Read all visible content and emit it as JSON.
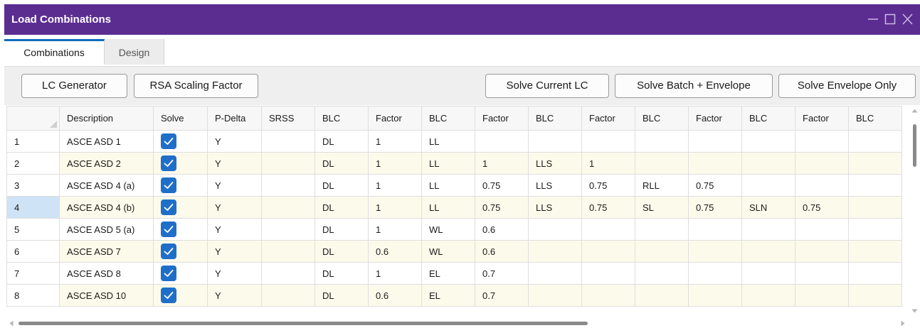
{
  "window": {
    "title": "Load Combinations"
  },
  "tabs": [
    {
      "label": "Combinations",
      "active": true
    },
    {
      "label": "Design",
      "active": false
    }
  ],
  "toolbar": {
    "lc_generator": "LC Generator",
    "rsa_scaling": "RSA Scaling Factor",
    "solve_current": "Solve Current LC",
    "solve_batch": "Solve Batch + Envelope",
    "solve_envelope": "Solve Envelope Only"
  },
  "grid": {
    "headers": [
      "",
      "Description",
      "Solve",
      "P-Delta",
      "SRSS",
      "BLC",
      "Factor",
      "BLC",
      "Factor",
      "BLC",
      "Factor",
      "BLC",
      "Factor",
      "BLC",
      "Factor",
      "BLC"
    ],
    "selected_row": 4,
    "rows": [
      {
        "num": "1",
        "desc": "ASCE ASD 1",
        "solve": true,
        "pdelta": "Y",
        "srss": "",
        "cells": [
          "DL",
          "1",
          "LL",
          "",
          "",
          "",
          "",
          "",
          "",
          "",
          ""
        ]
      },
      {
        "num": "2",
        "desc": "ASCE ASD 2",
        "solve": true,
        "pdelta": "Y",
        "srss": "",
        "cells": [
          "DL",
          "1",
          "LL",
          "1",
          "LLS",
          "1",
          "",
          "",
          "",
          "",
          ""
        ]
      },
      {
        "num": "3",
        "desc": "ASCE ASD 4 (a)",
        "solve": true,
        "pdelta": "Y",
        "srss": "",
        "cells": [
          "DL",
          "1",
          "LL",
          "0.75",
          "LLS",
          "0.75",
          "RLL",
          "0.75",
          "",
          "",
          ""
        ]
      },
      {
        "num": "4",
        "desc": "ASCE ASD 4 (b)",
        "solve": true,
        "pdelta": "Y",
        "srss": "",
        "cells": [
          "DL",
          "1",
          "LL",
          "0.75",
          "LLS",
          "0.75",
          "SL",
          "0.75",
          "SLN",
          "0.75",
          ""
        ]
      },
      {
        "num": "5",
        "desc": "ASCE ASD 5 (a)",
        "solve": true,
        "pdelta": "Y",
        "srss": "",
        "cells": [
          "DL",
          "1",
          "WL",
          "0.6",
          "",
          "",
          "",
          "",
          "",
          "",
          ""
        ]
      },
      {
        "num": "6",
        "desc": "ASCE ASD 7",
        "solve": true,
        "pdelta": "Y",
        "srss": "",
        "cells": [
          "DL",
          "0.6",
          "WL",
          "0.6",
          "",
          "",
          "",
          "",
          "",
          "",
          ""
        ]
      },
      {
        "num": "7",
        "desc": "ASCE ASD 8",
        "solve": true,
        "pdelta": "Y",
        "srss": "",
        "cells": [
          "DL",
          "1",
          "EL",
          "0.7",
          "",
          "",
          "",
          "",
          "",
          "",
          ""
        ]
      },
      {
        "num": "8",
        "desc": "ASCE ASD 10",
        "solve": true,
        "pdelta": "Y",
        "srss": "",
        "cells": [
          "DL",
          "0.6",
          "EL",
          "0.7",
          "",
          "",
          "",
          "",
          "",
          "",
          ""
        ]
      }
    ]
  },
  "icons": {
    "minimize": "minimize-icon",
    "maximize": "maximize-icon",
    "close": "close-icon",
    "checkbox": "checkmark-icon"
  },
  "colors": {
    "titlebar": "#5b2d91",
    "accent": "#1f6fc9",
    "alt_row": "#fcfaea",
    "selected_row_header": "#cfe3f6"
  }
}
